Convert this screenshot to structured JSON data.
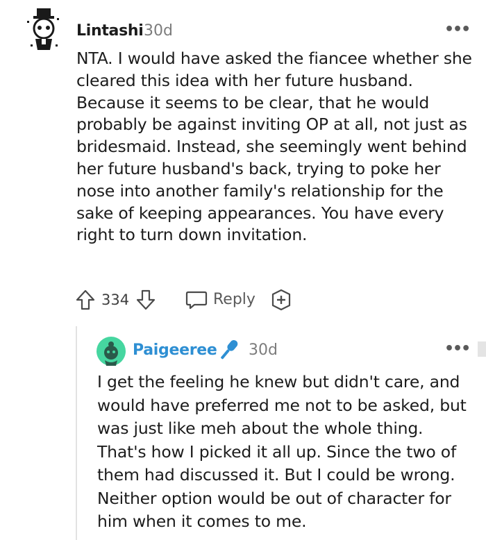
{
  "comment": {
    "author": "Lintashi",
    "age": "30d",
    "more_label": "•••",
    "body": "NTA. I would have asked the fiancee whether she cleared this idea with her future husband. Because it seems to be clear, that he would probably be against inviting OP at all, not just as bridesmaid. Instead, she seemingly went behind her future husband's back, trying to poke her nose into another family's relationship for the sake of keeping appearances. You have every right to turn down invitation.",
    "score": "334",
    "reply_label": "Reply",
    "icons": [
      "avatar",
      "upvote-icon",
      "downvote-icon",
      "reply-icon",
      "award-icon",
      "more-icon"
    ]
  },
  "reply": {
    "author": "Paigeeree",
    "age": "30d",
    "more_label": "•••",
    "body": "I get the feeling he knew but didn't care, and would have preferred me not to be asked, but was just like meh about the whole thing. That's how I picked it all up. Since the two of them had discussed it. But I could be wrong. Neither option would be out of character for him when it comes to me.",
    "username_color": "#2e8fd3",
    "icons": [
      "avatar",
      "microphone-icon",
      "more-icon"
    ]
  }
}
